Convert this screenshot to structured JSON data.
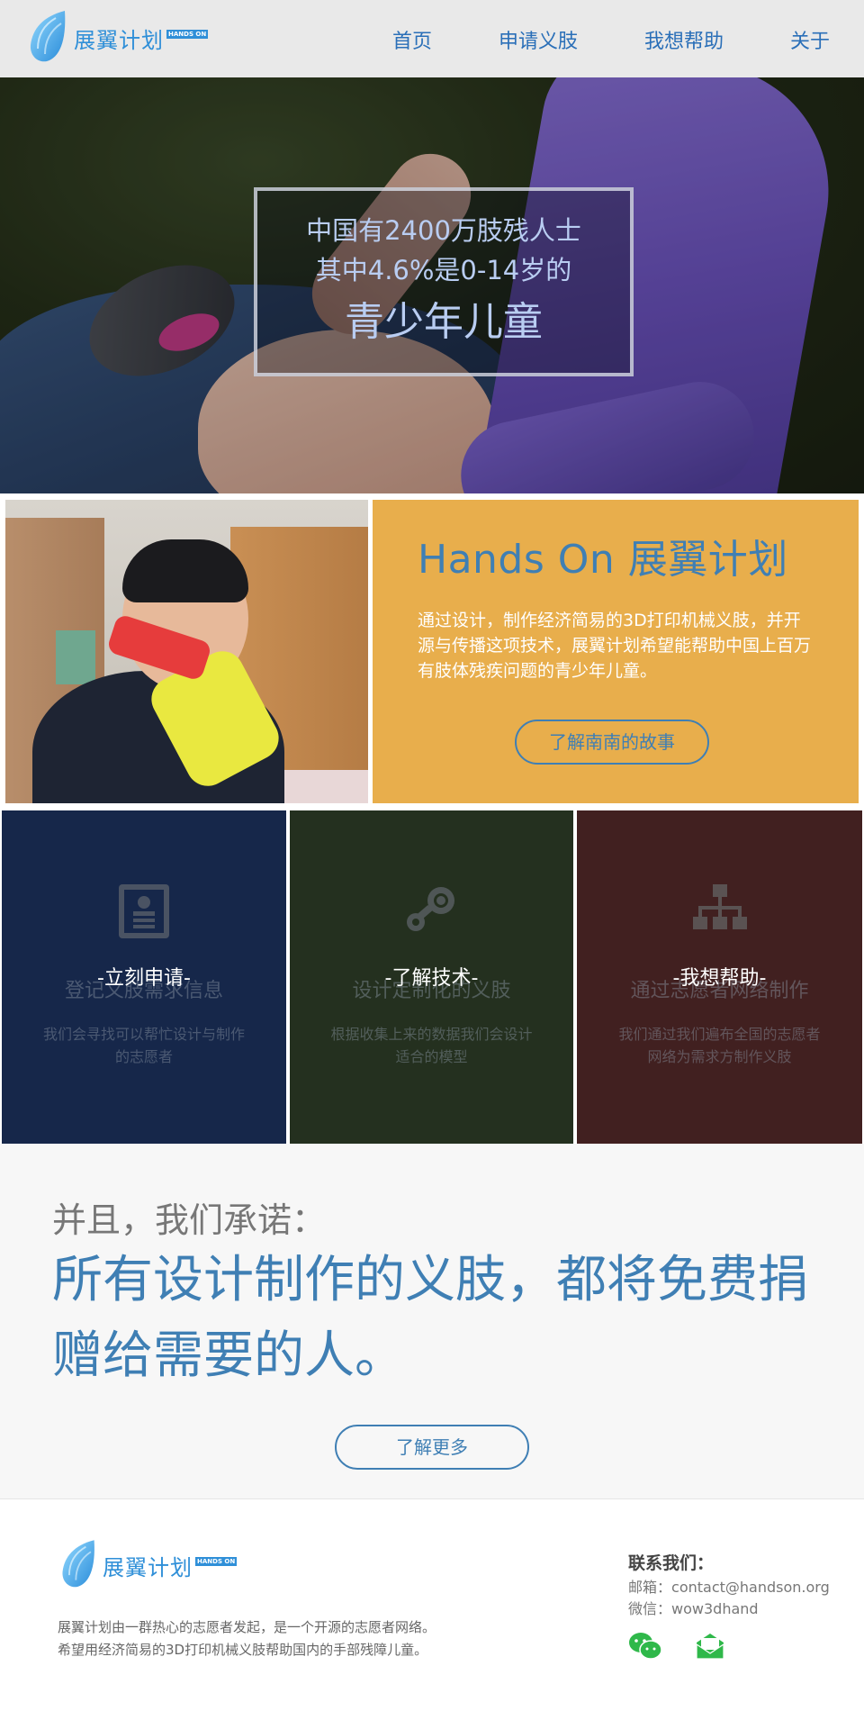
{
  "nav": {
    "logo_text": "展翼计划",
    "logo_badge": "HANDS ON",
    "links": [
      "首页",
      "申请义肢",
      "我想帮助",
      "关于"
    ]
  },
  "hero": {
    "line1": "中国有2400万肢残人士",
    "line2": "其中4.6%是0-14岁的",
    "line3": "青少年儿童"
  },
  "intro": {
    "title": "Hands On 展翼计划",
    "body": "通过设计，制作经济简易的3D打印机械义肢，并开源与传播这项技术，展翼计划希望能帮助中国上百万有肢体残疾问题的青少年儿童。",
    "button": "了解南南的故事"
  },
  "features": [
    {
      "icon": "id-card-icon",
      "title": "-立刻申请-",
      "subtitle": "登记义肢需求信息",
      "desc": "我们会寻找可以帮忙设计与制作的志愿者"
    },
    {
      "icon": "steam-icon",
      "title": "-了解技术-",
      "subtitle": "设计定制化的义肢",
      "desc": "根据收集上来的数据我们会设计适合的模型"
    },
    {
      "icon": "sitemap-icon",
      "title": "-我想帮助-",
      "subtitle": "通过志愿者网络制作",
      "desc": "我们通过我们遍布全国的志愿者网络为需求方制作义肢"
    }
  ],
  "promise": {
    "lead": "并且，我们承诺：",
    "statement": "所有设计制作的义肢，都将免费捐赠给需要的人。",
    "button": "了解更多"
  },
  "footer": {
    "logo_text": "展翼计划",
    "logo_badge": "HANDS ON",
    "desc_line1": "展翼计划由一群热心的志愿者发起，是一个开源的志愿者网络。",
    "desc_line2": "希望用经济简易的3D打印机械义肢帮助国内的手部残障儿童。",
    "contact_title": "联系我们：",
    "email_label": "邮箱：",
    "email": "contact@handson.org",
    "wechat_label": "微信：",
    "wechat": "wow3dhand"
  },
  "colors": {
    "accent": "#3f7fb4",
    "orange": "#e8ae4c",
    "tile_blue": "#16274a",
    "tile_green": "#24301f",
    "tile_red": "#412020",
    "wechat_green": "#2fb84a"
  }
}
